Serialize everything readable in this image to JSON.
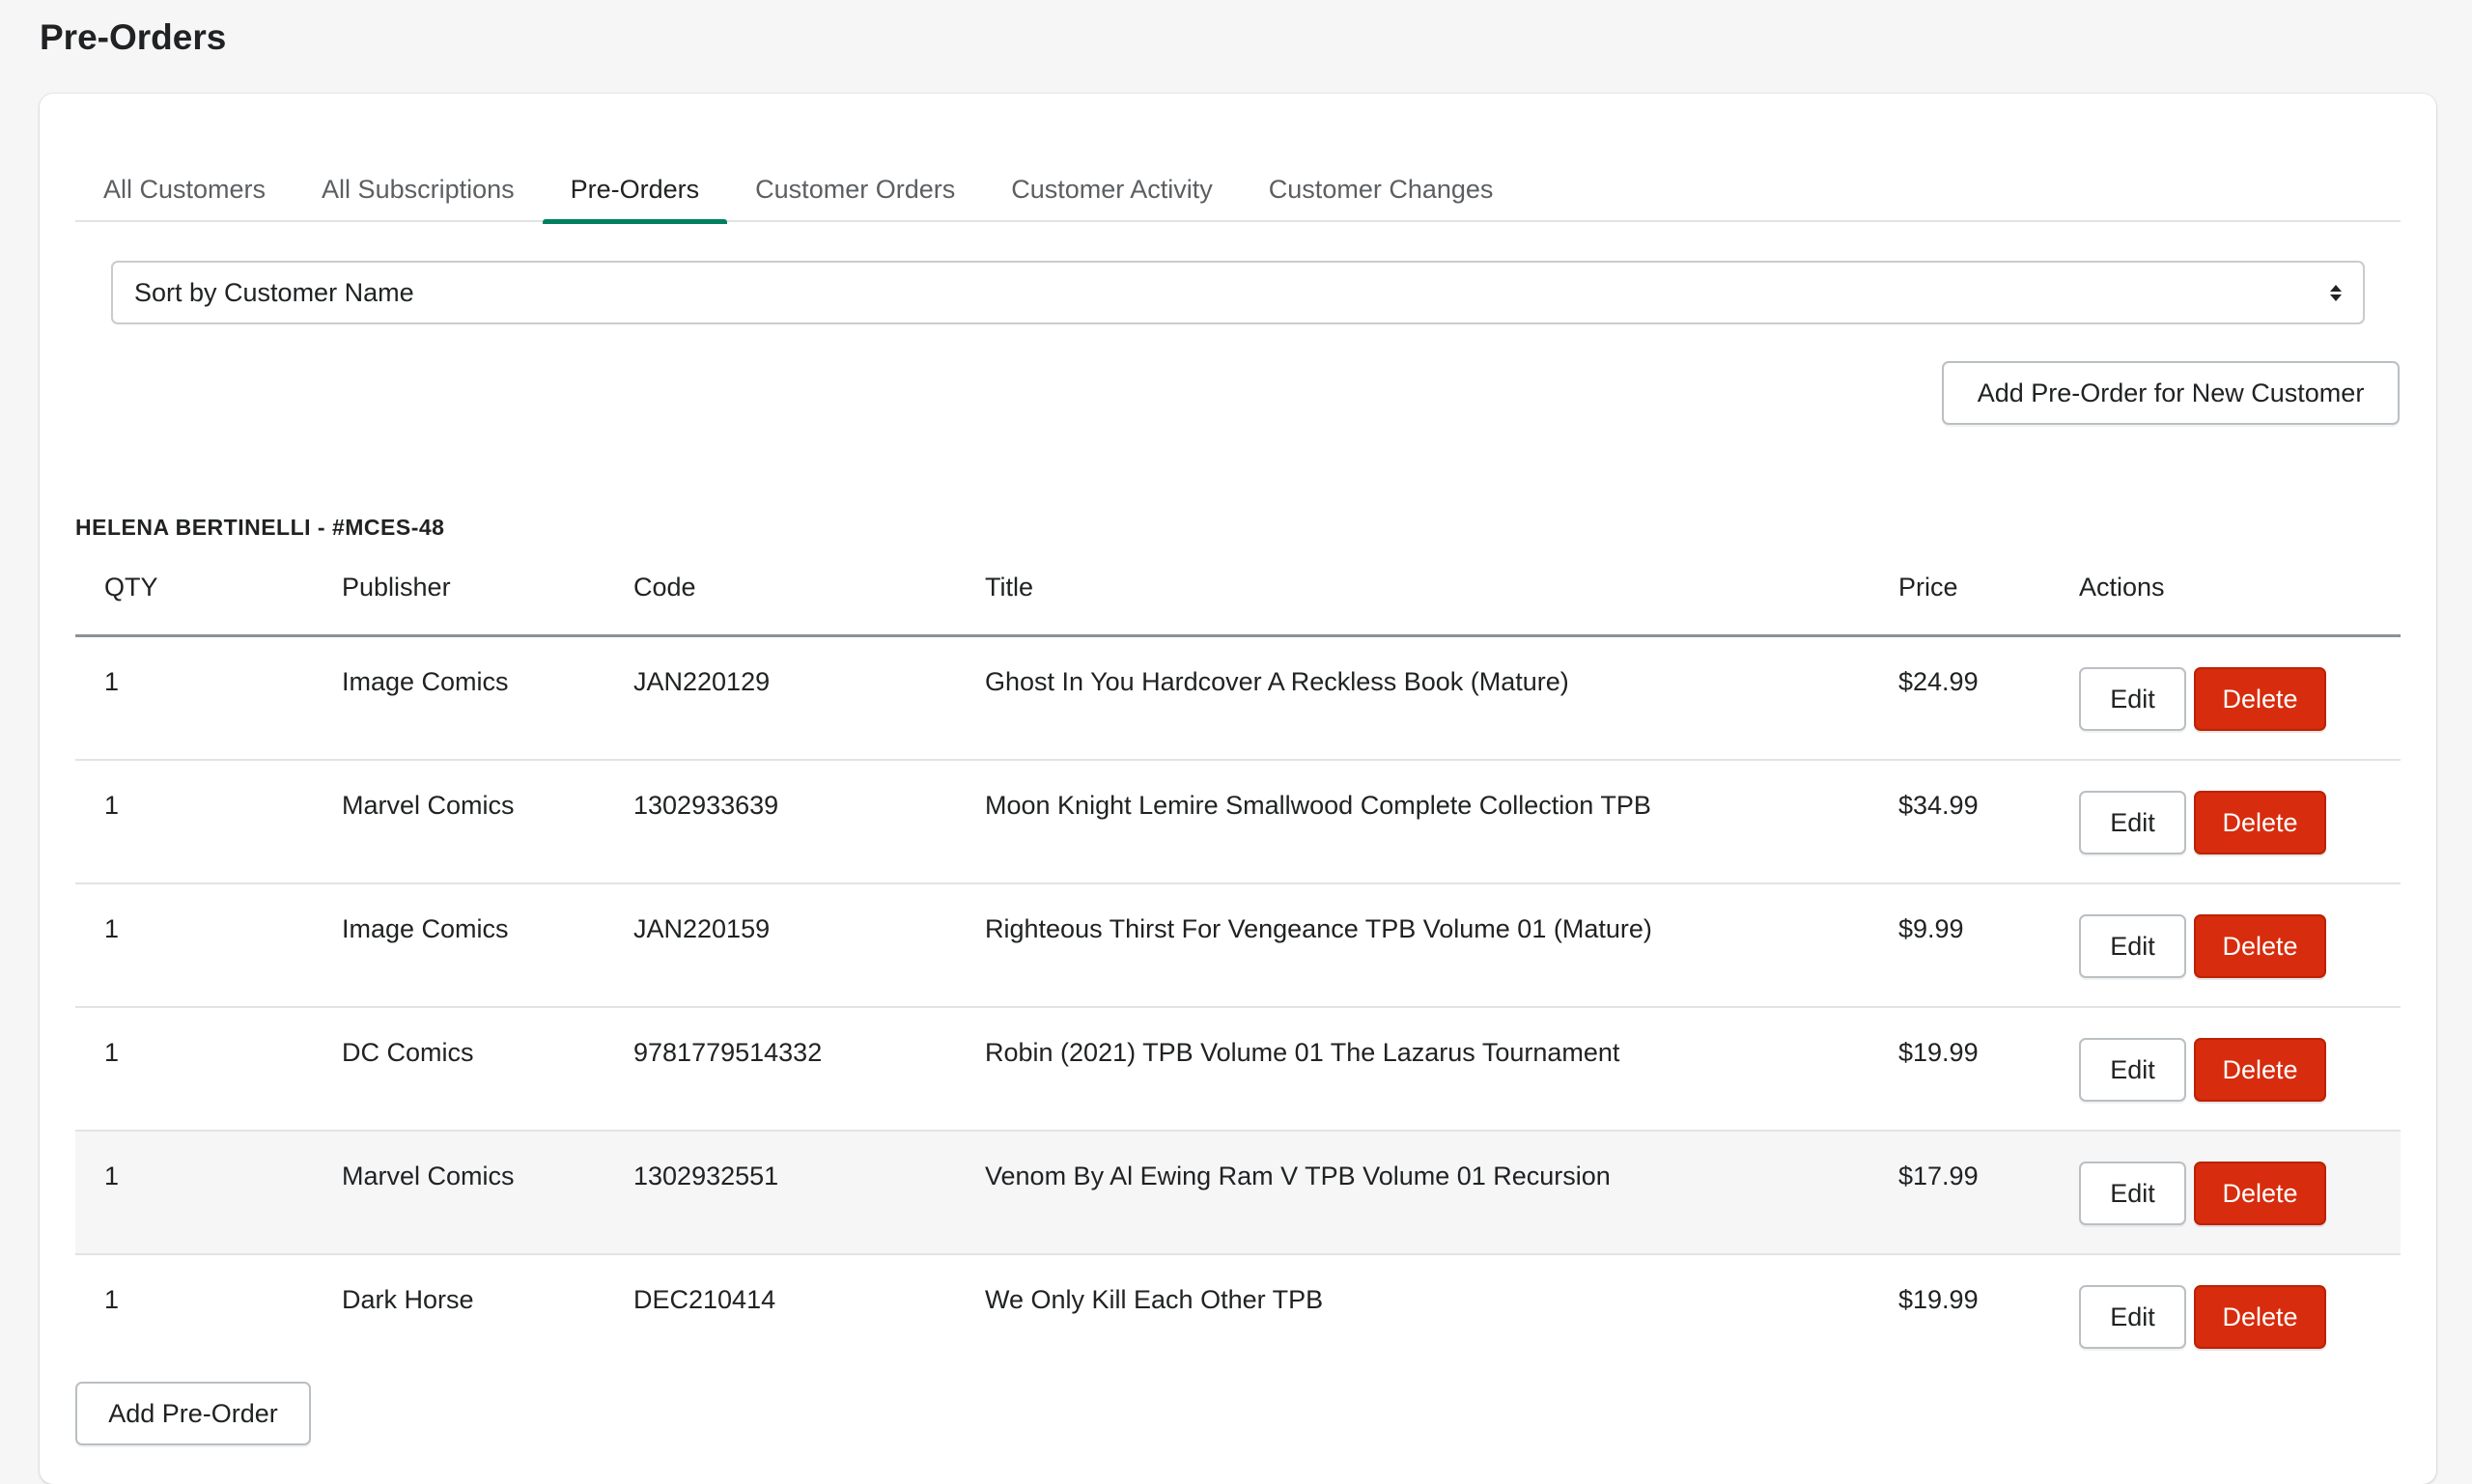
{
  "page": {
    "title": "Pre-Orders"
  },
  "tabs": [
    {
      "label": "All Customers",
      "active": false
    },
    {
      "label": "All Subscriptions",
      "active": false
    },
    {
      "label": "Pre-Orders",
      "active": true
    },
    {
      "label": "Customer Orders",
      "active": false
    },
    {
      "label": "Customer Activity",
      "active": false
    },
    {
      "label": "Customer Changes",
      "active": false
    }
  ],
  "sort": {
    "selected": "Sort by Customer Name",
    "icon": "select-updown-icon"
  },
  "buttons": {
    "add_new_customer": "Add Pre-Order for New Customer",
    "add_preorder": "Add Pre-Order",
    "edit": "Edit",
    "delete": "Delete"
  },
  "customer": {
    "heading": "HELENA BERTINELLI - #MCES-48"
  },
  "table": {
    "headers": {
      "qty": "QTY",
      "publisher": "Publisher",
      "code": "Code",
      "title": "Title",
      "price": "Price",
      "actions": "Actions"
    },
    "rows": [
      {
        "qty": "1",
        "publisher": "Image Comics",
        "code": "JAN220129",
        "title": "Ghost In You Hardcover A Reckless Book (Mature)",
        "price": "$24.99"
      },
      {
        "qty": "1",
        "publisher": "Marvel Comics",
        "code": "1302933639",
        "title": "Moon Knight Lemire Smallwood Complete Collection TPB",
        "price": "$34.99"
      },
      {
        "qty": "1",
        "publisher": "Image Comics",
        "code": "JAN220159",
        "title": "Righteous Thirst For Vengeance TPB Volume 01 (Mature)",
        "price": "$9.99"
      },
      {
        "qty": "1",
        "publisher": "DC Comics",
        "code": "9781779514332",
        "title": "Robin (2021) TPB Volume 01 The Lazarus Tournament",
        "price": "$19.99"
      },
      {
        "qty": "1",
        "publisher": "Marvel Comics",
        "code": "1302932551",
        "title": "Venom By Al Ewing Ram V TPB Volume 01 Recursion",
        "price": "$17.99"
      },
      {
        "qty": "1",
        "publisher": "Dark Horse",
        "code": "DEC210414",
        "title": "We Only Kill Each Other TPB",
        "price": "$19.99"
      }
    ]
  },
  "colors": {
    "accent": "#008060",
    "danger": "#d72c0d",
    "background": "#f6f6f6"
  }
}
